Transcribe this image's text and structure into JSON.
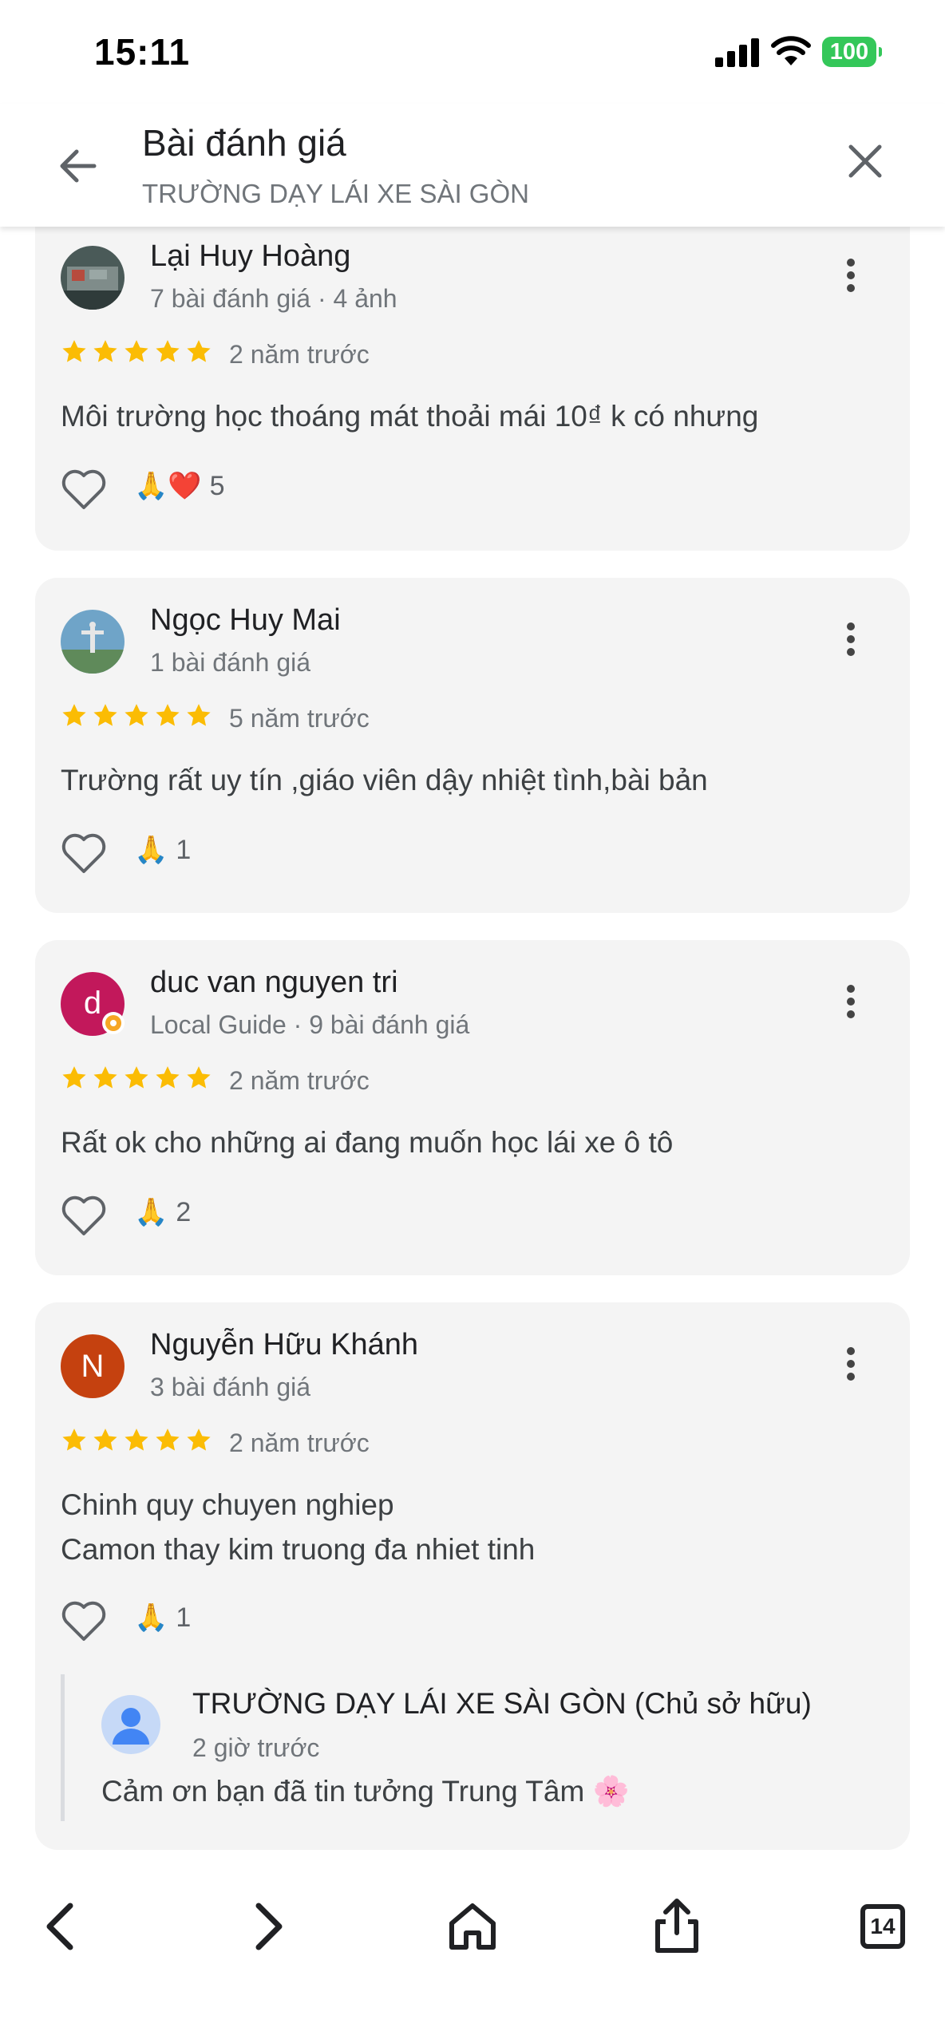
{
  "status_bar": {
    "time": "15:11",
    "battery": "100",
    "battery_color": "#34c759"
  },
  "header": {
    "title": "Bài đánh giá",
    "subtitle": "TRƯỜNG DẠY LÁI XE SÀI GÒN"
  },
  "colors": {
    "star": "#fbbc04",
    "card_bg": "#f4f4f4"
  },
  "reviews": [
    {
      "name": "Lại Huy Hoàng",
      "meta": "7 bài đánh giá · 4 ảnh",
      "rating": 5,
      "time": "2 năm trước",
      "text": "Môi trường học thoáng mát thoải mái 10₫ k có nhưng",
      "reactions": "🙏❤️",
      "reaction_count": "5",
      "avatar": "photo"
    },
    {
      "name": "Ngọc Huy Mai",
      "meta": "1 bài đánh giá",
      "rating": 5,
      "time": "5 năm trước",
      "text": "Trường rất uy tín ,giáo viên dậy nhiệt tình,bài bản",
      "reactions": "🙏",
      "reaction_count": "1",
      "avatar": "photo"
    },
    {
      "name": "duc van nguyen tri",
      "meta": "Local Guide · 9 bài đánh giá",
      "rating": 5,
      "time": "2 năm trước",
      "text": "Rất ok cho những ai đang muốn học lái xe ô tô",
      "reactions": "🙏",
      "reaction_count": "2",
      "avatar_letter": "d",
      "avatar_color": "#c2185b"
    },
    {
      "name": "Nguyễn Hữu Khánh",
      "meta": "3 bài đánh giá",
      "rating": 5,
      "time": "2 năm trước",
      "text": "Chinh quy chuyen nghiep\nCamon thay kim truong đa nhiet tinh",
      "reactions": "🙏",
      "reaction_count": "1",
      "avatar_letter": "N",
      "avatar_color": "#c5410f",
      "owner_reply": {
        "name": "TRƯỜNG DẠY LÁI XE SÀI GÒN (Chủ sở hữu)",
        "time": "2 giờ trước",
        "text": "Cảm ơn bạn đã tin tưởng Trung Tâm 🌸"
      }
    }
  ],
  "bottom_nav": {
    "tab_count": "14"
  }
}
